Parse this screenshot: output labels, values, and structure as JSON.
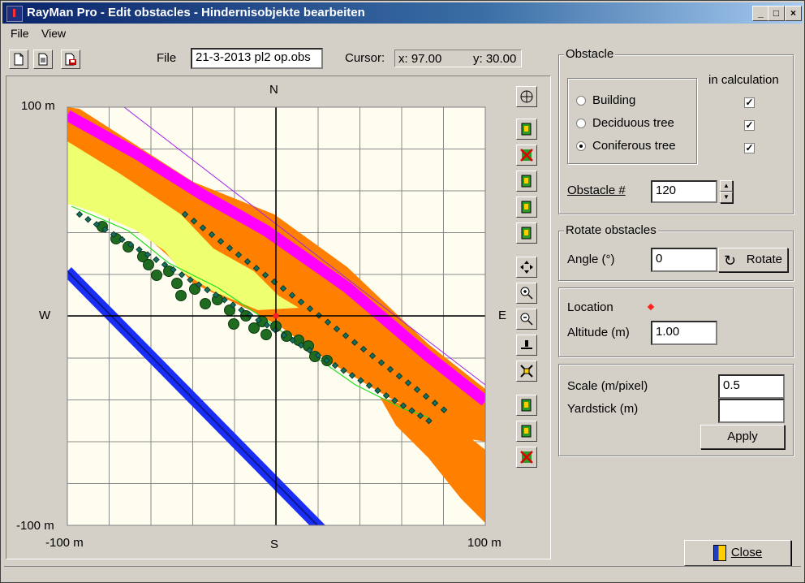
{
  "window": {
    "title": "RayMan Pro - Edit obstacles - Hindernisobjekte bearbeiten",
    "controls": {
      "minimize": "_",
      "maximize": "□",
      "close": "×"
    }
  },
  "menu": {
    "file": "File",
    "view": "View"
  },
  "toolbar": {
    "icons": [
      "new-file-icon",
      "open-file-icon",
      "save-file-icon"
    ]
  },
  "file": {
    "label": "File",
    "value": "21-3-2013 pl2 op.obs"
  },
  "cursor": {
    "label": "Cursor:",
    "x": "x: 97.00",
    "y": "y: 30.00"
  },
  "plot": {
    "north": "N",
    "south": "S",
    "west": "W",
    "east": "E",
    "y_top": "100 m",
    "y_bottom": "-100 m",
    "x_left": "-100 m",
    "x_right": "100 m",
    "colors": {
      "background": "#fffdf0",
      "grid": "#808080",
      "orange": "#ff8000",
      "magenta": "#ff00ff",
      "lime": "#eeff70",
      "blue": "#1a2ef5",
      "tree": "#1f6b1f",
      "dot": "#16705a",
      "line": "#a020f0"
    }
  },
  "side_tools": [
    "center-view-icon",
    "add-obstacle-icon",
    "delete-obstacle-icon",
    "copy-obstacle-icon",
    "paste-obstacle-icon",
    "duplicate-obstacle-icon",
    "pan-icon",
    "zoom-in-icon",
    "zoom-out-icon",
    "set-level-icon",
    "fit-view-icon",
    "import-obstacles-icon",
    "export-obstacles-icon",
    "clear-obstacles-icon"
  ],
  "obstacle": {
    "group_title": "Obstacle",
    "in_calculation": "in calculation",
    "types": [
      {
        "label": "Building",
        "selected": false,
        "in_calc": true
      },
      {
        "label": "Deciduous tree",
        "selected": false,
        "in_calc": true
      },
      {
        "label": "Coniferous tree",
        "selected": true,
        "in_calc": true
      }
    ],
    "number_label": "Obstacle #",
    "number_value": "120"
  },
  "rotate": {
    "group_title": "Rotate obstacles",
    "angle_label": "Angle (°)",
    "angle_value": "0",
    "button": "Rotate"
  },
  "location": {
    "label": "Location",
    "altitude_label": "Altitude (m)",
    "altitude_value": "1.00"
  },
  "scale": {
    "label": "Scale (m/pixel)",
    "value": "0.5",
    "yardstick_label": "Yardstick (m)",
    "yardstick_value": "",
    "apply": "Apply"
  },
  "close_button": "Close"
}
